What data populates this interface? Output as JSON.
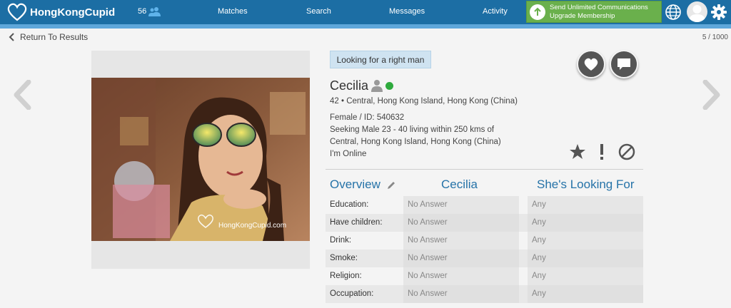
{
  "header": {
    "logo_text": "HongKongCupid",
    "notification_count": "56",
    "nav": [
      "Matches",
      "Search",
      "Messages",
      "Activity"
    ],
    "upgrade_line1": "Send Unlimited Communications",
    "upgrade_line2": "Upgrade Membership",
    "brand_color": "#1c6ea4",
    "upgrade_color": "#6ab04c"
  },
  "back_link": "Return To Results",
  "result_counter": "5 / 1000",
  "profile": {
    "badge": "Looking for a right man",
    "name": "Cecilia",
    "location": "42 • Central, Hong Kong Island, Hong Kong (China)",
    "gender_id": "Female / ID: 540632",
    "seeking_line1": "Seeking Male 23 - 40 living within 250 kms of",
    "seeking_line2": "Central, Hong Kong Island, Hong Kong (China)",
    "status": "I'm Online",
    "photo_watermark": "HongKongCupid.com",
    "online_color": "#2eaa3d"
  },
  "details": {
    "headers": [
      "Overview",
      "Cecilia",
      "She's Looking For"
    ],
    "rows": [
      {
        "label": "Education:",
        "her": "No Answer",
        "looking": "Any"
      },
      {
        "label": "Have children:",
        "her": "No Answer",
        "looking": "Any"
      },
      {
        "label": "Drink:",
        "her": "No Answer",
        "looking": "Any"
      },
      {
        "label": "Smoke:",
        "her": "No Answer",
        "looking": "Any"
      },
      {
        "label": "Religion:",
        "her": "No Answer",
        "looking": "Any"
      },
      {
        "label": "Occupation:",
        "her": "No Answer",
        "looking": "Any"
      }
    ]
  }
}
